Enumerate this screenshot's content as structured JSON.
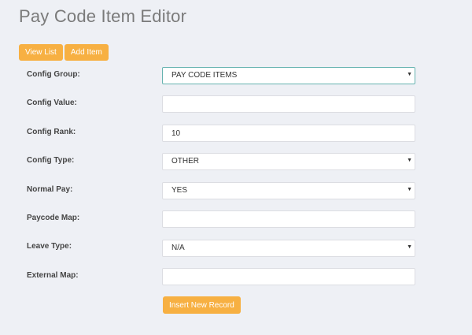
{
  "page": {
    "title": "Pay Code Item Editor"
  },
  "toolbar": {
    "view_list_label": "View List",
    "add_item_label": "Add Item"
  },
  "form": {
    "config_group": {
      "label": "Config Group:",
      "value": "PAY CODE ITEMS"
    },
    "config_value": {
      "label": "Config Value:",
      "value": ""
    },
    "config_rank": {
      "label": "Config Rank:",
      "value": "10"
    },
    "config_type": {
      "label": "Config Type:",
      "value": "OTHER"
    },
    "normal_pay": {
      "label": "Normal Pay:",
      "value": "YES"
    },
    "paycode_map": {
      "label": "Paycode Map:",
      "value": ""
    },
    "leave_type": {
      "label": "Leave Type:",
      "value": "N/A"
    },
    "external_map": {
      "label": "External Map:",
      "value": ""
    },
    "submit_label": "Insert New Record"
  },
  "icons": {
    "dropdown_caret": "▼"
  },
  "colors": {
    "accent": "#f7b042",
    "focus_border": "#66b3b0",
    "background": "#eef0f5"
  }
}
